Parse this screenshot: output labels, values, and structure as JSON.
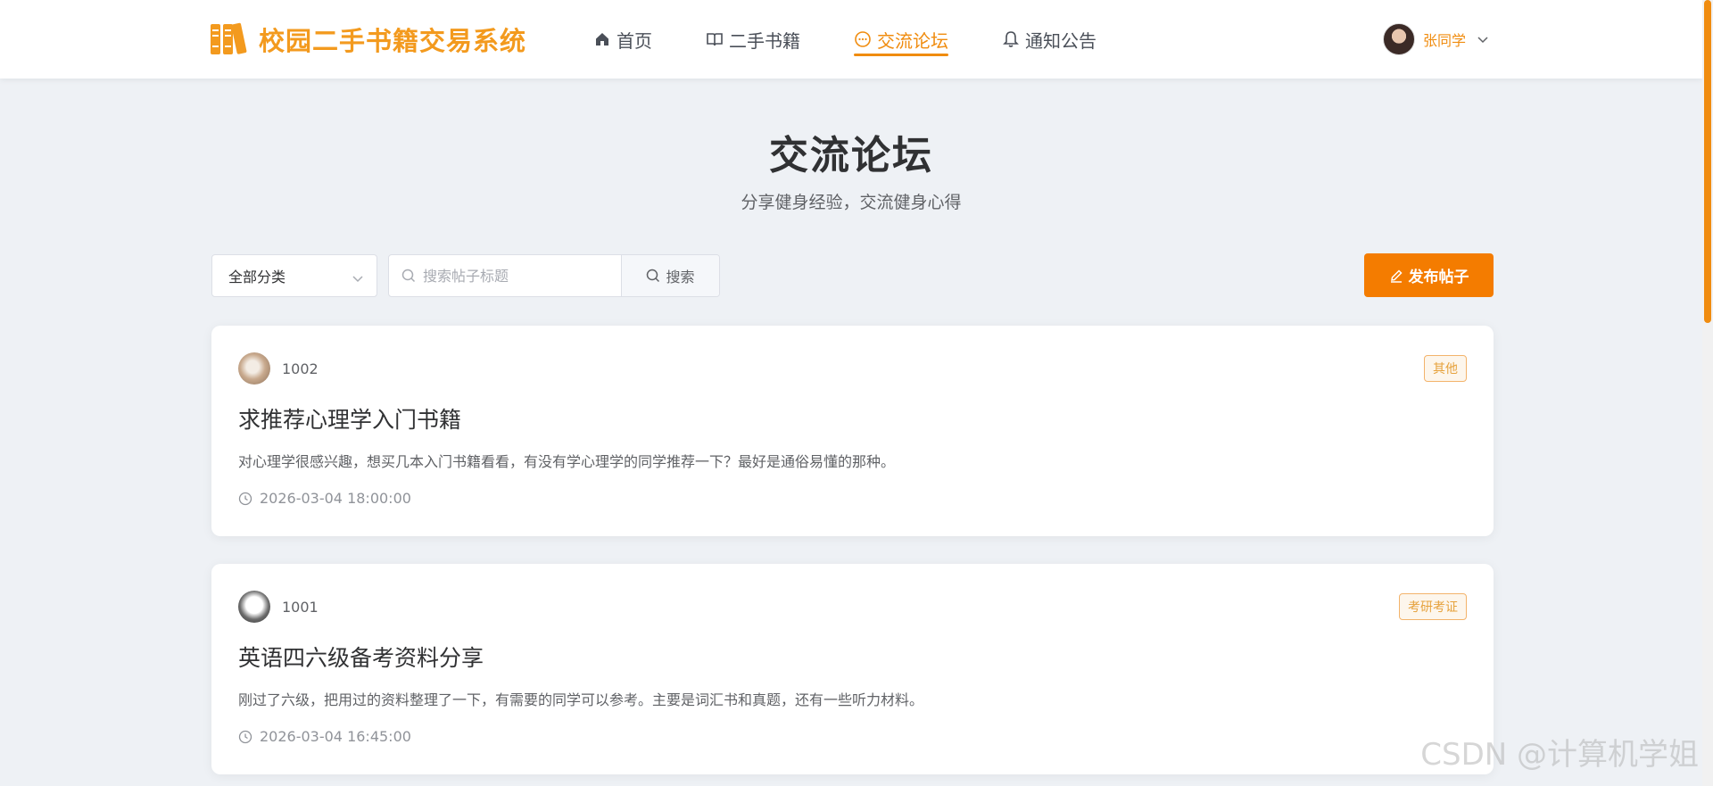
{
  "app": {
    "title": "校园二手书籍交易系统",
    "accent_color": "#f08c0f",
    "primary_button_color": "#f47c00"
  },
  "nav": {
    "items": [
      {
        "label": "首页",
        "icon": "home-icon",
        "active": false
      },
      {
        "label": "二手书籍",
        "icon": "book-icon",
        "active": false
      },
      {
        "label": "交流论坛",
        "icon": "chat-icon",
        "active": true
      },
      {
        "label": "通知公告",
        "icon": "bell-icon",
        "active": false
      }
    ]
  },
  "user": {
    "name": "张同学",
    "icon": "chevron-down-icon"
  },
  "page": {
    "title": "交流论坛",
    "subtitle": "分享健身经验，交流健身心得"
  },
  "toolbar": {
    "category_selected": "全部分类",
    "search_placeholder": "搜索帖子标题",
    "search_button": "搜索",
    "publish_button": "发布帖子"
  },
  "posts": [
    {
      "author": "1002",
      "tag": "其他",
      "title": "求推荐心理学入门书籍",
      "content": "对心理学很感兴趣，想买几本入门书籍看看，有没有学心理学的同学推荐一下？最好是通俗易懂的那种。",
      "time": "2026-03-04 18:00:00"
    },
    {
      "author": "1001",
      "tag": "考研考证",
      "title": "英语四六级备考资料分享",
      "content": "刚过了六级，把用过的资料整理了一下，有需要的同学可以参考。主要是词汇书和真题，还有一些听力材料。",
      "time": "2026-03-04 16:45:00"
    }
  ],
  "watermark": "CSDN @计算机学姐"
}
